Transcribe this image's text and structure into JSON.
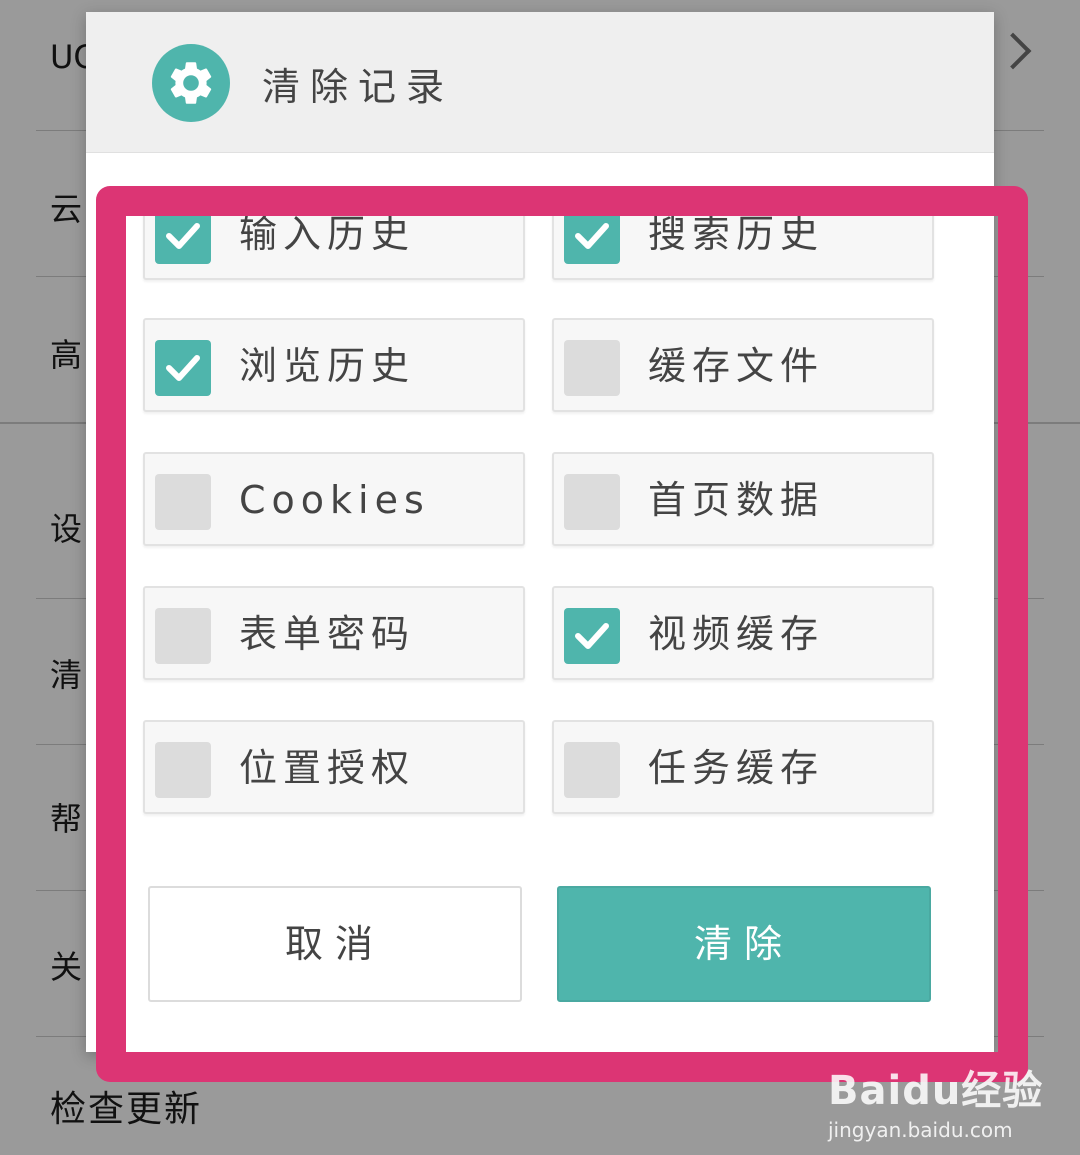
{
  "background": {
    "row_labels": [
      "UC",
      "云",
      "高",
      "设",
      "清",
      "帮",
      "关"
    ],
    "last_item": "检查更新"
  },
  "dialog": {
    "title": "清除记录",
    "icon": "gear-icon",
    "options": [
      {
        "label": "输入历史",
        "checked": true
      },
      {
        "label": "搜索历史",
        "checked": true
      },
      {
        "label": "浏览历史",
        "checked": true
      },
      {
        "label": "缓存文件",
        "checked": false
      },
      {
        "label": "Cookies",
        "checked": false
      },
      {
        "label": "首页数据",
        "checked": false
      },
      {
        "label": "表单密码",
        "checked": false
      },
      {
        "label": "视频缓存",
        "checked": true
      },
      {
        "label": "位置授权",
        "checked": false
      },
      {
        "label": "任务缓存",
        "checked": false
      }
    ],
    "cancel_label": "取消",
    "clear_label": "清除"
  },
  "watermark": {
    "logo": "Baidu经验",
    "url": "jingyan.baidu.com"
  },
  "colors": {
    "accent": "#4fb5ac",
    "highlight": "#dc3574",
    "unchecked": "#dcdcdc"
  }
}
